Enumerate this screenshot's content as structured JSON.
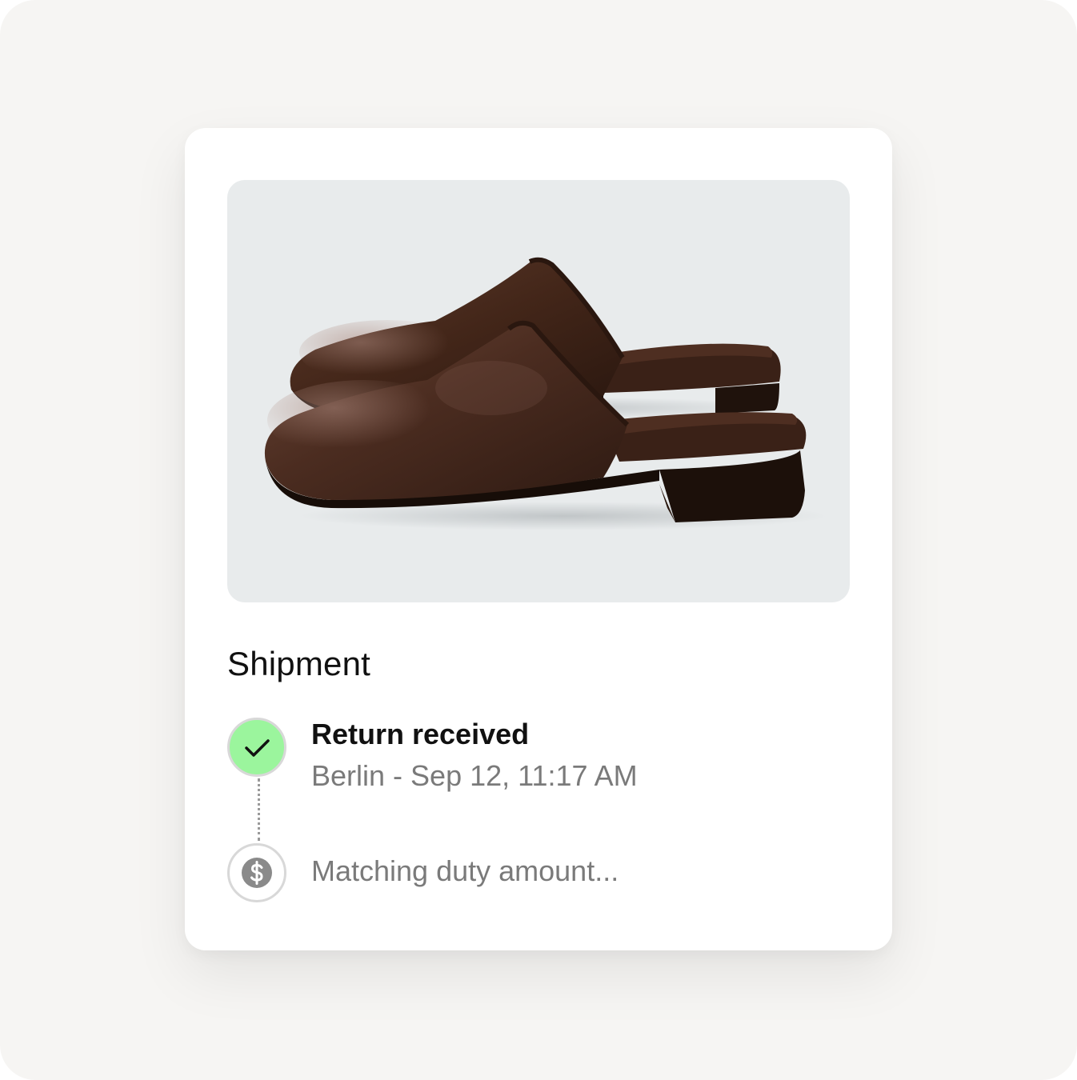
{
  "shipment": {
    "title": "Shipment",
    "steps": [
      {
        "status": "complete",
        "icon": "check-icon",
        "label": "Return received",
        "detail": "Berlin - Sep 12, 11:17 AM"
      },
      {
        "status": "pending",
        "icon": "dollar-icon",
        "label": "Matching duty amount..."
      }
    ]
  },
  "product_image": {
    "depicts": "pair of brown leather mules",
    "icon": "product-photo"
  },
  "colors": {
    "page_background": "#f6f5f3",
    "card_background": "#ffffff",
    "photo_background": "#e8ebec",
    "complete_accent": "#9bf59d",
    "muted_text": "#7a7a7a"
  }
}
